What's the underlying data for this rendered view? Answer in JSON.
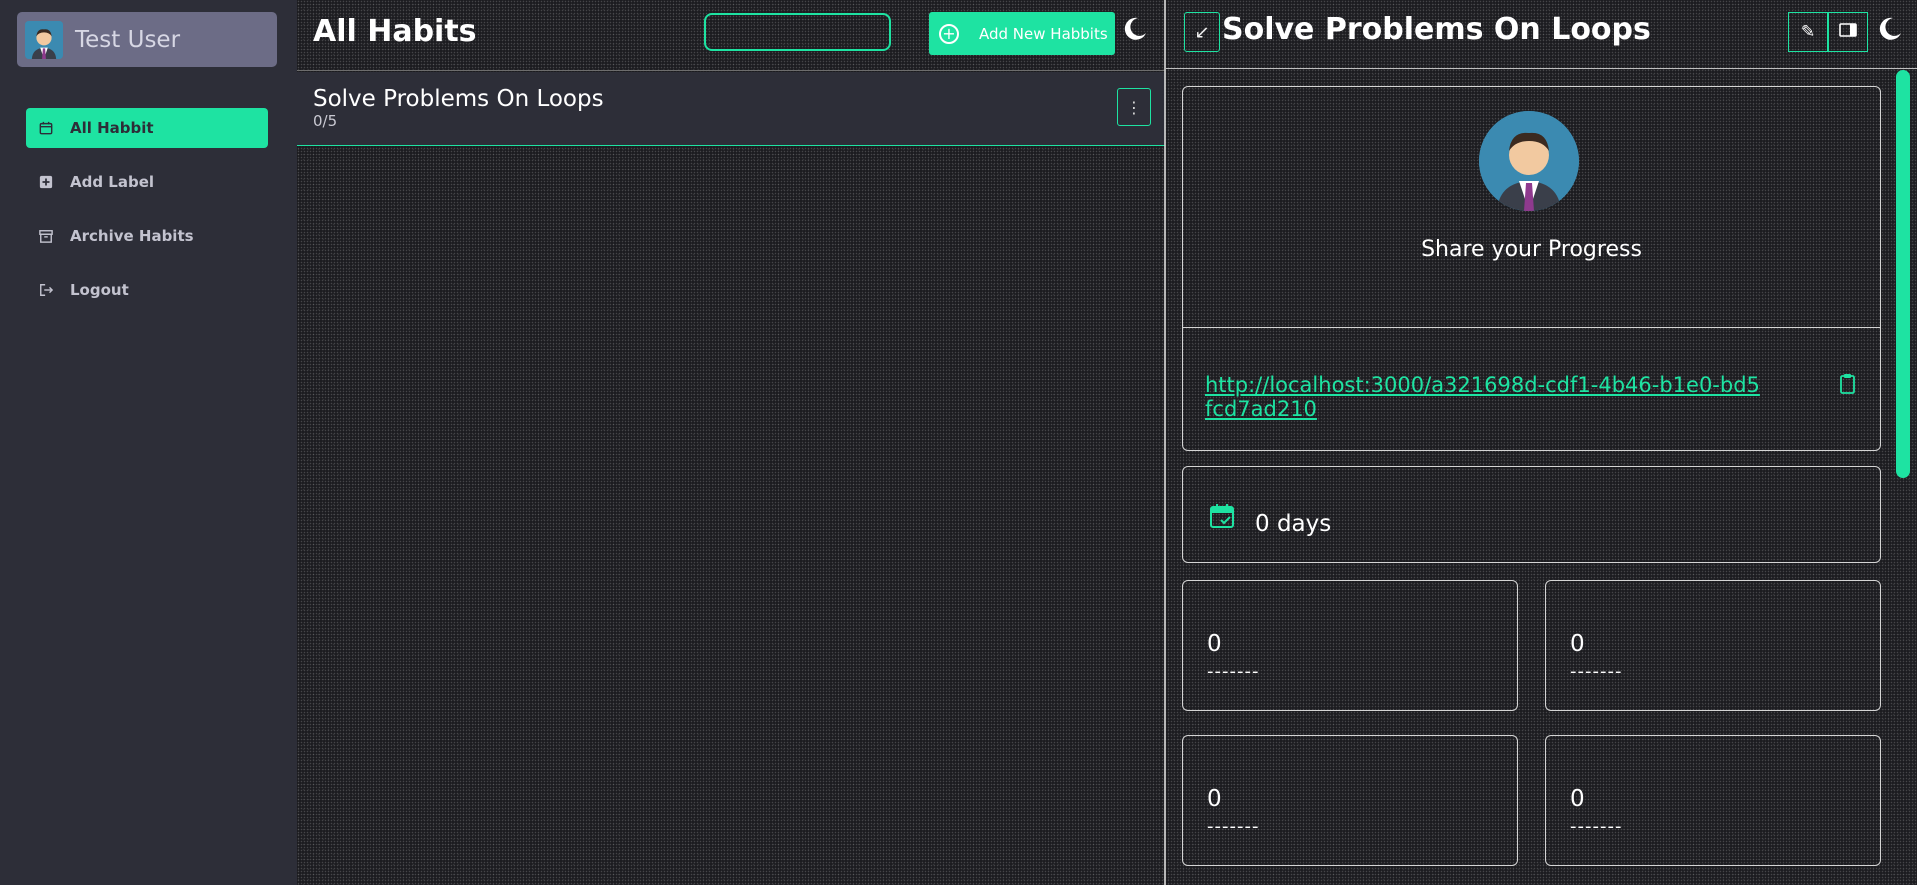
{
  "user": {
    "name": "Test User"
  },
  "sidebar": {
    "items": [
      {
        "label": "All Habbit",
        "icon": "calendar-icon",
        "active": true
      },
      {
        "label": "Add Label",
        "icon": "plus-square-icon",
        "active": false
      },
      {
        "label": "Archive Habits",
        "icon": "archive-icon",
        "active": false
      },
      {
        "label": "Logout",
        "icon": "logout-icon",
        "active": false
      }
    ]
  },
  "header": {
    "title": "All Habits",
    "search_value": "",
    "add_label": "Add New Habbits"
  },
  "habits": [
    {
      "title": "Solve Problems On Loops",
      "progress": "0/5"
    }
  ],
  "detail": {
    "title": "Solve Problems On Loops",
    "share_label": "Share your Progress",
    "share_link": "http://localhost:3000/a321698d-cdf1-4b46-b1e0-bd5fcd7ad210",
    "streak": "0 days",
    "stats": [
      {
        "value": "0",
        "label": "-------"
      },
      {
        "value": "0",
        "label": "-------"
      },
      {
        "value": "0",
        "label": "-------"
      },
      {
        "value": "0",
        "label": "-------"
      }
    ]
  },
  "colors": {
    "accent": "#1ee3a2",
    "sidebar": "#2d2e38",
    "user_card": "#6c6c86"
  }
}
